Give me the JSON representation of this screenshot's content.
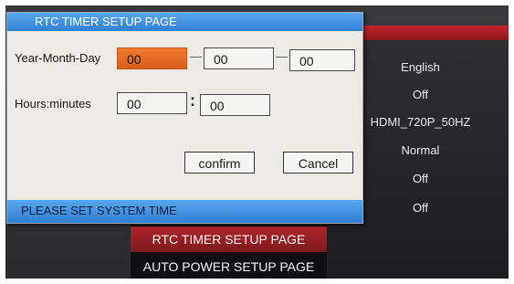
{
  "background": {
    "settings_values": [
      "English",
      "Off",
      "HDMI_720P_50HZ",
      "Normal",
      "Off",
      "Off"
    ],
    "menu_items": [
      "RTC TIMER SETUP PAGE",
      "AUTO POWER SETUP PAGE"
    ]
  },
  "dialog": {
    "title": "RTC TIMER SETUP PAGE",
    "date_label": "Year-Month-Day",
    "year": "00",
    "month": "00",
    "day": "00",
    "date_separator": "—",
    "time_label": "Hours:minutes",
    "hours": "00",
    "minutes": "00",
    "time_separator": ":",
    "confirm_label": "confirm",
    "cancel_label": "Cancel",
    "status": "PLEASE  SET  SYSTEM TIME"
  },
  "colors": {
    "accent_blue": "#2f7fd4",
    "focus_orange": "#e86a24",
    "menu_red": "#b0242a"
  }
}
